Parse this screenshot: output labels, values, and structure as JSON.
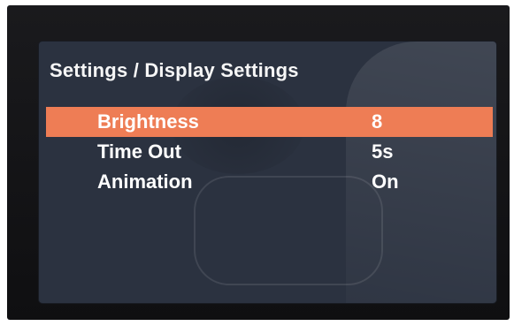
{
  "screen": {
    "title": "Settings / Display Settings",
    "accent_color": "#ee7d55",
    "background_color": "#2b3240"
  },
  "menu": {
    "items": [
      {
        "label": "Brightness",
        "value": "8"
      },
      {
        "label": "Time Out",
        "value": "5s"
      },
      {
        "label": "Animation",
        "value": "On"
      }
    ]
  }
}
